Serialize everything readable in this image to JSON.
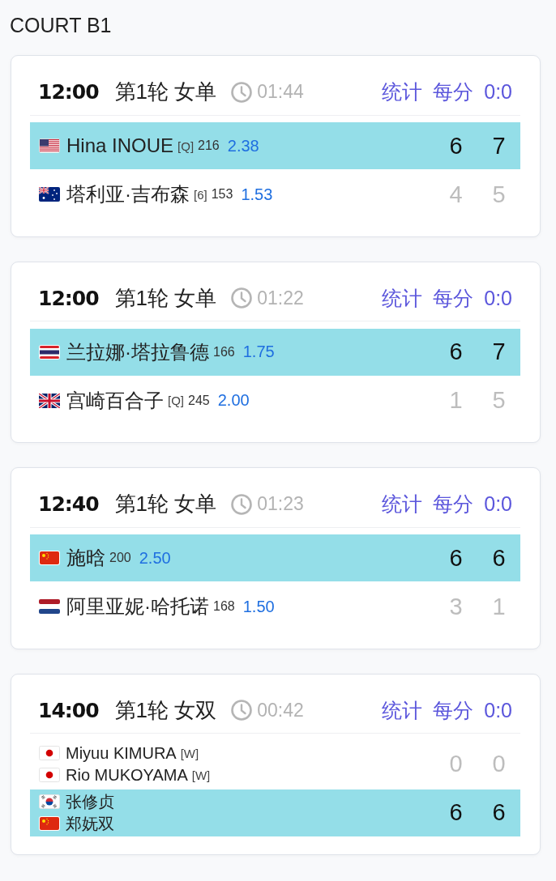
{
  "court": {
    "title": "COURT B1"
  },
  "matches": [
    {
      "time": "12:00",
      "round": "第1轮 女单",
      "duration": "01:44",
      "links": [
        {
          "label": "统计"
        },
        {
          "label": "每分"
        },
        {
          "label": "0:0"
        }
      ],
      "teams": [
        {
          "winner": true,
          "players": [
            {
              "flag": {
                "kind": "us"
              },
              "name": "Hina INOUE",
              "seed": "[Q]",
              "rank": "216"
            }
          ],
          "odds": "2.38",
          "scores": [
            "6",
            "7"
          ]
        },
        {
          "winner": false,
          "players": [
            {
              "flag": {
                "kind": "au"
              },
              "name": "塔利亚·吉布森",
              "seed": "[6]",
              "rank": "153"
            }
          ],
          "odds": "1.53",
          "scores": [
            "4",
            "5"
          ]
        }
      ]
    },
    {
      "time": "12:00",
      "round": "第1轮 女单",
      "duration": "01:22",
      "links": [
        {
          "label": "统计"
        },
        {
          "label": "每分"
        },
        {
          "label": "0:0"
        }
      ],
      "teams": [
        {
          "winner": true,
          "players": [
            {
              "flag": {
                "kind": "th"
              },
              "name": "兰拉娜·塔拉鲁德",
              "rank": "166"
            }
          ],
          "odds": "1.75",
          "scores": [
            "6",
            "7"
          ]
        },
        {
          "winner": false,
          "players": [
            {
              "flag": {
                "kind": "gb"
              },
              "name": "宫崎百合子",
              "seed": "[Q]",
              "rank": "245"
            }
          ],
          "odds": "2.00",
          "scores": [
            "1",
            "5"
          ]
        }
      ]
    },
    {
      "time": "12:40",
      "round": "第1轮 女单",
      "duration": "01:23",
      "links": [
        {
          "label": "统计"
        },
        {
          "label": "每分"
        },
        {
          "label": "0:0"
        }
      ],
      "teams": [
        {
          "winner": true,
          "players": [
            {
              "flag": {
                "kind": "cn"
              },
              "name": "施晗",
              "rank": "200"
            }
          ],
          "odds": "2.50",
          "scores": [
            "6",
            "6"
          ]
        },
        {
          "winner": false,
          "players": [
            {
              "flag": {
                "kind": "nl"
              },
              "name": "阿里亚妮·哈托诺",
              "rank": "168"
            }
          ],
          "odds": "1.50",
          "scores": [
            "3",
            "1"
          ]
        }
      ]
    },
    {
      "time": "14:00",
      "round": "第1轮 女双",
      "duration": "00:42",
      "links": [
        {
          "label": "统计"
        },
        {
          "label": "每分"
        },
        {
          "label": "0:0"
        }
      ],
      "teams": [
        {
          "winner": false,
          "players": [
            {
              "flag": {
                "kind": "jp"
              },
              "name": "Miyuu KIMURA",
              "seed": "[W]"
            },
            {
              "flag": {
                "kind": "jp"
              },
              "name": "Rio MUKOYAMA",
              "seed": "[W]"
            }
          ],
          "scores": [
            "0",
            "0"
          ]
        },
        {
          "winner": true,
          "players": [
            {
              "flag": {
                "kind": "kr"
              },
              "name": "张修贞"
            },
            {
              "flag": {
                "kind": "cn"
              },
              "name": "郑妩双"
            }
          ],
          "scores": [
            "6",
            "6"
          ]
        }
      ]
    }
  ]
}
